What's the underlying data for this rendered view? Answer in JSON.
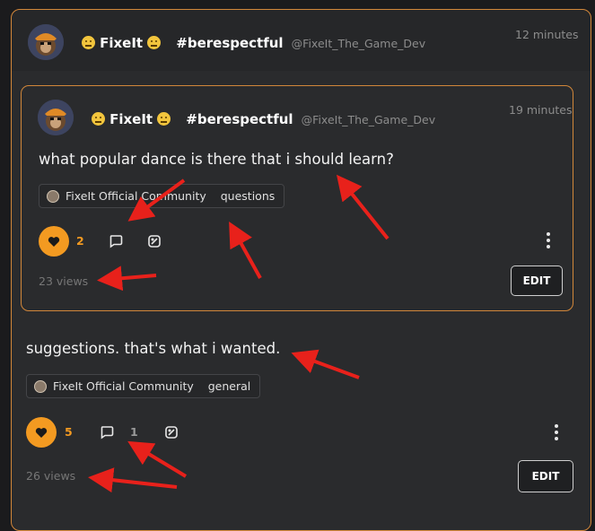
{
  "outer_post": {
    "author_name": "FixeIt",
    "hashtag": "#berespectful",
    "handle": "@FixeIt_The_Game_Dev",
    "time": "12 minutes",
    "body": "suggestions. that's what i wanted.",
    "community": "FixeIt Official Community",
    "category": "general",
    "like_count": "5",
    "comment_count": "1",
    "views": "26 views",
    "edit_label": "EDIT"
  },
  "quoted_post": {
    "author_name": "FixeIt",
    "hashtag": "#berespectful",
    "handle": "@FixeIt_The_Game_Dev",
    "time": "19 minutes",
    "title": "what popular dance is there that i should learn?",
    "community": "FixeIt Official Community",
    "category": "questions",
    "like_count": "2",
    "views": "23 views",
    "edit_label": "EDIT"
  },
  "colors": {
    "accent": "#f39a21",
    "border": "#d2873a",
    "annotation_arrow": "#e8211b"
  }
}
